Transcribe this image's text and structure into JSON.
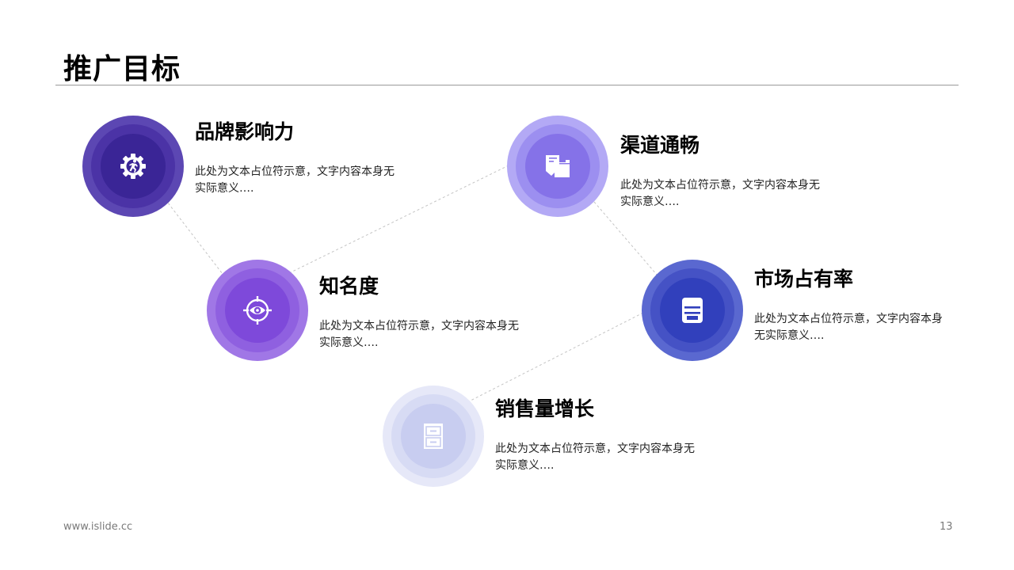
{
  "page": {
    "title": "推广目标",
    "footer_url": "www.islide.cc",
    "page_number": "13"
  },
  "items": [
    {
      "title": "品牌影响力",
      "description": "此处为文本占位符示意，文字内容本身无实际意义….",
      "icon": "gear-runner-icon",
      "colors": {
        "outer": "#5c47b3",
        "mid": "#4b33a6",
        "inner": "#3a2596"
      }
    },
    {
      "title": "渠道通畅",
      "description": "此处为文本占位符示意，文字内容本身无实际意义….",
      "icon": "documents-icon",
      "colors": {
        "outer": "#b3a9f5",
        "mid": "#9c8ff0",
        "inner": "#8572e8"
      }
    },
    {
      "title": "知名度",
      "description": "此处为文本占位符示意，文字内容本身无实际意义….",
      "icon": "target-eye-icon",
      "colors": {
        "outer": "#a077e6",
        "mid": "#8f60e0",
        "inner": "#7e49da"
      }
    },
    {
      "title": "市场占有率",
      "description": "此处为文本占位符示意，文字内容本身无实际意义….",
      "icon": "printer-icon",
      "colors": {
        "outer": "#5a68d0",
        "mid": "#4552c5",
        "inner": "#3140bc"
      }
    },
    {
      "title": "销售量增长",
      "description": "此处为文本占位符示意，文字内容本身无实际意义….",
      "icon": "file-cabinet-icon",
      "colors": {
        "outer": "#e6e8f8",
        "mid": "#d7dbf4",
        "inner": "#c8cdf0"
      }
    }
  ]
}
